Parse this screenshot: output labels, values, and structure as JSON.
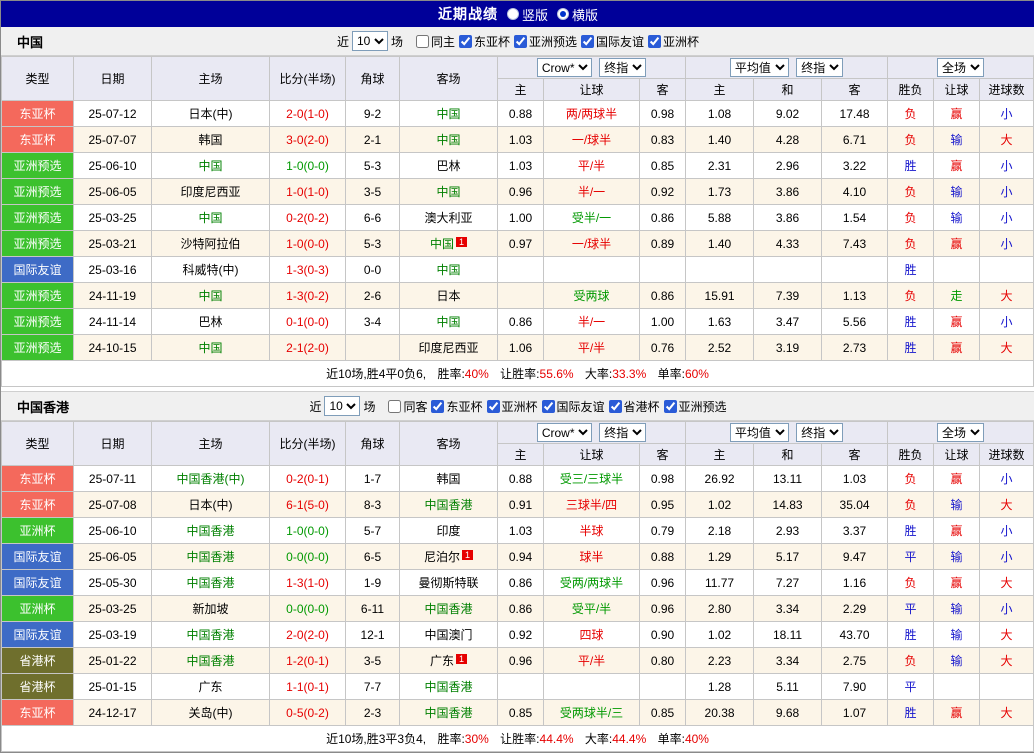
{
  "title_bar": {
    "title": "近期战绩",
    "vertical_label": "竖版",
    "horizontal_label": "横版",
    "selected": "横版"
  },
  "colors": {
    "red": "#e60000",
    "blue": "#1414cc",
    "green": "#009900",
    "team_green": "#008000",
    "badge_red": "#f4695c",
    "badge_green": "#3cc12e",
    "badge_blue": "#3e6bc6",
    "badge_olive": "#6f6f2d",
    "title_bar_bg": "#000099"
  },
  "columns": {
    "type": "类型",
    "date": "日期",
    "home": "主场",
    "score": "比分(半场)",
    "corner": "角球",
    "away": "客场",
    "asia_home": "主",
    "asia_handicap": "让球",
    "asia_away": "客",
    "euro_home": "主",
    "euro_draw": "和",
    "euro_away": "客",
    "result": "胜负",
    "handicap_result": "让球",
    "goals": "进球数"
  },
  "sections": [
    {
      "team": "中国",
      "near_label": "近",
      "count": "10",
      "games_label": "场",
      "same_label": "同主",
      "same_checked": false,
      "filters": [
        "东亚杯",
        "亚洲预选",
        "国际友谊",
        "亚洲杯"
      ],
      "dropdowns": {
        "asia_company": "Crow*",
        "asia_time": "终指",
        "euro_company": "平均值",
        "euro_time": "终指",
        "scope": "全场"
      },
      "rows": [
        {
          "type": "东亚杯",
          "badge": "red",
          "date": "25-07-12",
          "home": "日本(中)",
          "home_focus": false,
          "home_card": "",
          "score": "2-0(1-0)",
          "score_color": "red",
          "corner": "9-2",
          "away": "中国",
          "away_focus": true,
          "away_card": "",
          "asia_home": "0.88",
          "handicap": "两/两球半",
          "handicap_color": "red",
          "asia_away": "0.98",
          "euro_home": "1.08",
          "euro_draw": "9.02",
          "euro_away": "17.48",
          "result": "负",
          "result_color": "red",
          "handicap_result": "赢",
          "handicap_result_color": "red",
          "goals": "小",
          "goals_color": "blue"
        },
        {
          "type": "东亚杯",
          "badge": "red",
          "date": "25-07-07",
          "home": "韩国",
          "home_focus": false,
          "home_card": "",
          "score": "3-0(2-0)",
          "score_color": "red",
          "corner": "2-1",
          "away": "中国",
          "away_focus": true,
          "away_card": "",
          "asia_home": "1.03",
          "handicap": "一/球半",
          "handicap_color": "red",
          "asia_away": "0.83",
          "euro_home": "1.40",
          "euro_draw": "4.28",
          "euro_away": "6.71",
          "result": "负",
          "result_color": "red",
          "handicap_result": "输",
          "handicap_result_color": "blue",
          "goals": "大",
          "goals_color": "red"
        },
        {
          "type": "亚洲预选",
          "badge": "green",
          "date": "25-06-10",
          "home": "中国",
          "home_focus": true,
          "home_card": "",
          "score": "1-0(0-0)",
          "score_color": "green",
          "corner": "5-3",
          "away": "巴林",
          "away_focus": false,
          "away_card": "",
          "asia_home": "1.03",
          "handicap": "平/半",
          "handicap_color": "red",
          "asia_away": "0.85",
          "euro_home": "2.31",
          "euro_draw": "2.96",
          "euro_away": "3.22",
          "result": "胜",
          "result_color": "blue",
          "handicap_result": "赢",
          "handicap_result_color": "red",
          "goals": "小",
          "goals_color": "blue"
        },
        {
          "type": "亚洲预选",
          "badge": "green",
          "date": "25-06-05",
          "home": "印度尼西亚",
          "home_focus": false,
          "home_card": "",
          "score": "1-0(1-0)",
          "score_color": "red",
          "corner": "3-5",
          "away": "中国",
          "away_focus": true,
          "away_card": "",
          "asia_home": "0.96",
          "handicap": "半/一",
          "handicap_color": "red",
          "asia_away": "0.92",
          "euro_home": "1.73",
          "euro_draw": "3.86",
          "euro_away": "4.10",
          "result": "负",
          "result_color": "red",
          "handicap_result": "输",
          "handicap_result_color": "blue",
          "goals": "小",
          "goals_color": "blue"
        },
        {
          "type": "亚洲预选",
          "badge": "green",
          "date": "25-03-25",
          "home": "中国",
          "home_focus": true,
          "home_card": "",
          "score": "0-2(0-2)",
          "score_color": "red",
          "corner": "6-6",
          "away": "澳大利亚",
          "away_focus": false,
          "away_card": "",
          "asia_home": "1.00",
          "handicap": "受半/一",
          "handicap_color": "green",
          "asia_away": "0.86",
          "euro_home": "5.88",
          "euro_draw": "3.86",
          "euro_away": "1.54",
          "result": "负",
          "result_color": "red",
          "handicap_result": "输",
          "handicap_result_color": "blue",
          "goals": "小",
          "goals_color": "blue"
        },
        {
          "type": "亚洲预选",
          "badge": "green",
          "date": "25-03-21",
          "home": "沙特阿拉伯",
          "home_focus": false,
          "home_card": "",
          "score": "1-0(0-0)",
          "score_color": "red",
          "corner": "5-3",
          "away": "中国",
          "away_focus": true,
          "away_card": "1",
          "asia_home": "0.97",
          "handicap": "一/球半",
          "handicap_color": "red",
          "asia_away": "0.89",
          "euro_home": "1.40",
          "euro_draw": "4.33",
          "euro_away": "7.43",
          "result": "负",
          "result_color": "red",
          "handicap_result": "赢",
          "handicap_result_color": "red",
          "goals": "小",
          "goals_color": "blue"
        },
        {
          "type": "国际友谊",
          "badge": "blue",
          "date": "25-03-16",
          "home": "科威特(中)",
          "home_focus": false,
          "home_card": "",
          "score": "1-3(0-3)",
          "score_color": "red",
          "corner": "0-0",
          "away": "中国",
          "away_focus": true,
          "away_card": "",
          "asia_home": "",
          "handicap": "",
          "handicap_color": "",
          "asia_away": "",
          "euro_home": "",
          "euro_draw": "",
          "euro_away": "",
          "result": "胜",
          "result_color": "blue",
          "handicap_result": "",
          "handicap_result_color": "",
          "goals": "",
          "goals_color": ""
        },
        {
          "type": "亚洲预选",
          "badge": "green",
          "date": "24-11-19",
          "home": "中国",
          "home_focus": true,
          "home_card": "",
          "score": "1-3(0-2)",
          "score_color": "red",
          "corner": "2-6",
          "away": "日本",
          "away_focus": false,
          "away_card": "",
          "asia_home": "",
          "handicap": "受两球",
          "handicap_color": "green",
          "asia_away": "0.86",
          "euro_home": "15.91",
          "euro_draw": "7.39",
          "euro_away": "1.13",
          "result": "负",
          "result_color": "red",
          "handicap_result": "走",
          "handicap_result_color": "green",
          "goals": "大",
          "goals_color": "red"
        },
        {
          "type": "亚洲预选",
          "badge": "green",
          "date": "24-11-14",
          "home": "巴林",
          "home_focus": false,
          "home_card": "",
          "score": "0-1(0-0)",
          "score_color": "red",
          "corner": "3-4",
          "away": "中国",
          "away_focus": true,
          "away_card": "",
          "asia_home": "0.86",
          "handicap": "半/一",
          "handicap_color": "red",
          "asia_away": "1.00",
          "euro_home": "1.63",
          "euro_draw": "3.47",
          "euro_away": "5.56",
          "result": "胜",
          "result_color": "blue",
          "handicap_result": "赢",
          "handicap_result_color": "red",
          "goals": "小",
          "goals_color": "blue"
        },
        {
          "type": "亚洲预选",
          "badge": "green",
          "date": "24-10-15",
          "home": "中国",
          "home_focus": true,
          "home_card": "",
          "score": "2-1(2-0)",
          "score_color": "red",
          "corner": "",
          "away": "印度尼西亚",
          "away_focus": false,
          "away_card": "",
          "asia_home": "1.06",
          "handicap": "平/半",
          "handicap_color": "red",
          "asia_away": "0.76",
          "euro_home": "2.52",
          "euro_draw": "3.19",
          "euro_away": "2.73",
          "result": "胜",
          "result_color": "blue",
          "handicap_result": "赢",
          "handicap_result_color": "red",
          "goals": "大",
          "goals_color": "red"
        }
      ],
      "summary": {
        "record": "近10场,胜4平0负6,",
        "win_label": "胜率:",
        "win_value": "40%",
        "handicap_label": "让胜率:",
        "handicap_value": "55.6%",
        "over_label": "大率:",
        "over_value": "33.3%",
        "single_label": "单率:",
        "single_value": "60%"
      }
    },
    {
      "team": "中国香港",
      "near_label": "近",
      "count": "10",
      "games_label": "场",
      "same_label": "同客",
      "same_checked": false,
      "filters": [
        "东亚杯",
        "亚洲杯",
        "国际友谊",
        "省港杯",
        "亚洲预选"
      ],
      "dropdowns": {
        "asia_company": "Crow*",
        "asia_time": "终指",
        "euro_company": "平均值",
        "euro_time": "终指",
        "scope": "全场"
      },
      "rows": [
        {
          "type": "东亚杯",
          "badge": "red",
          "date": "25-07-11",
          "home": "中国香港(中)",
          "home_focus": true,
          "home_card": "",
          "score": "0-2(0-1)",
          "score_color": "red",
          "corner": "1-7",
          "away": "韩国",
          "away_focus": false,
          "away_card": "",
          "asia_home": "0.88",
          "handicap": "受三/三球半",
          "handicap_color": "green",
          "asia_away": "0.98",
          "euro_home": "26.92",
          "euro_draw": "13.11",
          "euro_away": "1.03",
          "result": "负",
          "result_color": "red",
          "handicap_result": "赢",
          "handicap_result_color": "red",
          "goals": "小",
          "goals_color": "blue"
        },
        {
          "type": "东亚杯",
          "badge": "red",
          "date": "25-07-08",
          "home": "日本(中)",
          "home_focus": false,
          "home_card": "",
          "score": "6-1(5-0)",
          "score_color": "red",
          "corner": "8-3",
          "away": "中国香港",
          "away_focus": true,
          "away_card": "",
          "asia_home": "0.91",
          "handicap": "三球半/四",
          "handicap_color": "red",
          "asia_away": "0.95",
          "euro_home": "1.02",
          "euro_draw": "14.83",
          "euro_away": "35.04",
          "result": "负",
          "result_color": "red",
          "handicap_result": "输",
          "handicap_result_color": "blue",
          "goals": "大",
          "goals_color": "red"
        },
        {
          "type": "亚洲杯",
          "badge": "green",
          "date": "25-06-10",
          "home": "中国香港",
          "home_focus": true,
          "home_card": "",
          "score": "1-0(0-0)",
          "score_color": "green",
          "corner": "5-7",
          "away": "印度",
          "away_focus": false,
          "away_card": "",
          "asia_home": "1.03",
          "handicap": "半球",
          "handicap_color": "red",
          "asia_away": "0.79",
          "euro_home": "2.18",
          "euro_draw": "2.93",
          "euro_away": "3.37",
          "result": "胜",
          "result_color": "blue",
          "handicap_result": "赢",
          "handicap_result_color": "red",
          "goals": "小",
          "goals_color": "blue"
        },
        {
          "type": "国际友谊",
          "badge": "blue",
          "date": "25-06-05",
          "home": "中国香港",
          "home_focus": true,
          "home_card": "",
          "score": "0-0(0-0)",
          "score_color": "green",
          "corner": "6-5",
          "away": "尼泊尔",
          "away_focus": false,
          "away_card": "1",
          "asia_home": "0.94",
          "handicap": "球半",
          "handicap_color": "red",
          "asia_away": "0.88",
          "euro_home": "1.29",
          "euro_draw": "5.17",
          "euro_away": "9.47",
          "result": "平",
          "result_color": "blue",
          "handicap_result": "输",
          "handicap_result_color": "blue",
          "goals": "小",
          "goals_color": "blue"
        },
        {
          "type": "国际友谊",
          "badge": "blue",
          "date": "25-05-30",
          "home": "中国香港",
          "home_focus": true,
          "home_card": "",
          "score": "1-3(1-0)",
          "score_color": "red",
          "corner": "1-9",
          "away": "曼彻斯特联",
          "away_focus": false,
          "away_card": "",
          "asia_home": "0.86",
          "handicap": "受两/两球半",
          "handicap_color": "green",
          "asia_away": "0.96",
          "euro_home": "11.77",
          "euro_draw": "7.27",
          "euro_away": "1.16",
          "result": "负",
          "result_color": "red",
          "handicap_result": "赢",
          "handicap_result_color": "red",
          "goals": "大",
          "goals_color": "red"
        },
        {
          "type": "亚洲杯",
          "badge": "green",
          "date": "25-03-25",
          "home": "新加坡",
          "home_focus": false,
          "home_card": "",
          "score": "0-0(0-0)",
          "score_color": "green",
          "corner": "6-11",
          "away": "中国香港",
          "away_focus": true,
          "away_card": "",
          "asia_home": "0.86",
          "handicap": "受平/半",
          "handicap_color": "green",
          "asia_away": "0.96",
          "euro_home": "2.80",
          "euro_draw": "3.34",
          "euro_away": "2.29",
          "result": "平",
          "result_color": "blue",
          "handicap_result": "输",
          "handicap_result_color": "blue",
          "goals": "小",
          "goals_color": "blue"
        },
        {
          "type": "国际友谊",
          "badge": "blue",
          "date": "25-03-19",
          "home": "中国香港",
          "home_focus": true,
          "home_card": "",
          "score": "2-0(2-0)",
          "score_color": "red",
          "corner": "12-1",
          "away": "中国澳门",
          "away_focus": false,
          "away_card": "",
          "asia_home": "0.92",
          "handicap": "四球",
          "handicap_color": "red",
          "asia_away": "0.90",
          "euro_home": "1.02",
          "euro_draw": "18.11",
          "euro_away": "43.70",
          "result": "胜",
          "result_color": "blue",
          "handicap_result": "输",
          "handicap_result_color": "blue",
          "goals": "大",
          "goals_color": "red"
        },
        {
          "type": "省港杯",
          "badge": "olive",
          "date": "25-01-22",
          "home": "中国香港",
          "home_focus": true,
          "home_card": "",
          "score": "1-2(0-1)",
          "score_color": "red",
          "corner": "3-5",
          "away": "广东",
          "away_focus": false,
          "away_card": "1",
          "asia_home": "0.96",
          "handicap": "平/半",
          "handicap_color": "red",
          "asia_away": "0.80",
          "euro_home": "2.23",
          "euro_draw": "3.34",
          "euro_away": "2.75",
          "result": "负",
          "result_color": "red",
          "handicap_result": "输",
          "handicap_result_color": "blue",
          "goals": "大",
          "goals_color": "red"
        },
        {
          "type": "省港杯",
          "badge": "olive",
          "date": "25-01-15",
          "home": "广东",
          "home_focus": false,
          "home_card": "",
          "score": "1-1(0-1)",
          "score_color": "red",
          "corner": "7-7",
          "away": "中国香港",
          "away_focus": true,
          "away_card": "",
          "asia_home": "",
          "handicap": "",
          "handicap_color": "",
          "asia_away": "",
          "euro_home": "1.28",
          "euro_draw": "5.11",
          "euro_away": "7.90",
          "result": "平",
          "result_color": "blue",
          "handicap_result": "",
          "handicap_result_color": "",
          "goals": "",
          "goals_color": ""
        },
        {
          "type": "东亚杯",
          "badge": "red",
          "date": "24-12-17",
          "home": "关岛(中)",
          "home_focus": false,
          "home_card": "",
          "score": "0-5(0-2)",
          "score_color": "red",
          "corner": "2-3",
          "away": "中国香港",
          "away_focus": true,
          "away_card": "",
          "asia_home": "0.85",
          "handicap": "受两球半/三",
          "handicap_color": "green",
          "asia_away": "0.85",
          "euro_home": "20.38",
          "euro_draw": "9.68",
          "euro_away": "1.07",
          "result": "胜",
          "result_color": "blue",
          "handicap_result": "赢",
          "handicap_result_color": "red",
          "goals": "大",
          "goals_color": "red"
        }
      ],
      "summary": {
        "record": "近10场,胜3平3负4,",
        "win_label": "胜率:",
        "win_value": "30%",
        "handicap_label": "让胜率:",
        "handicap_value": "44.4%",
        "over_label": "大率:",
        "over_value": "44.4%",
        "single_label": "单率:",
        "single_value": "40%"
      }
    }
  ]
}
